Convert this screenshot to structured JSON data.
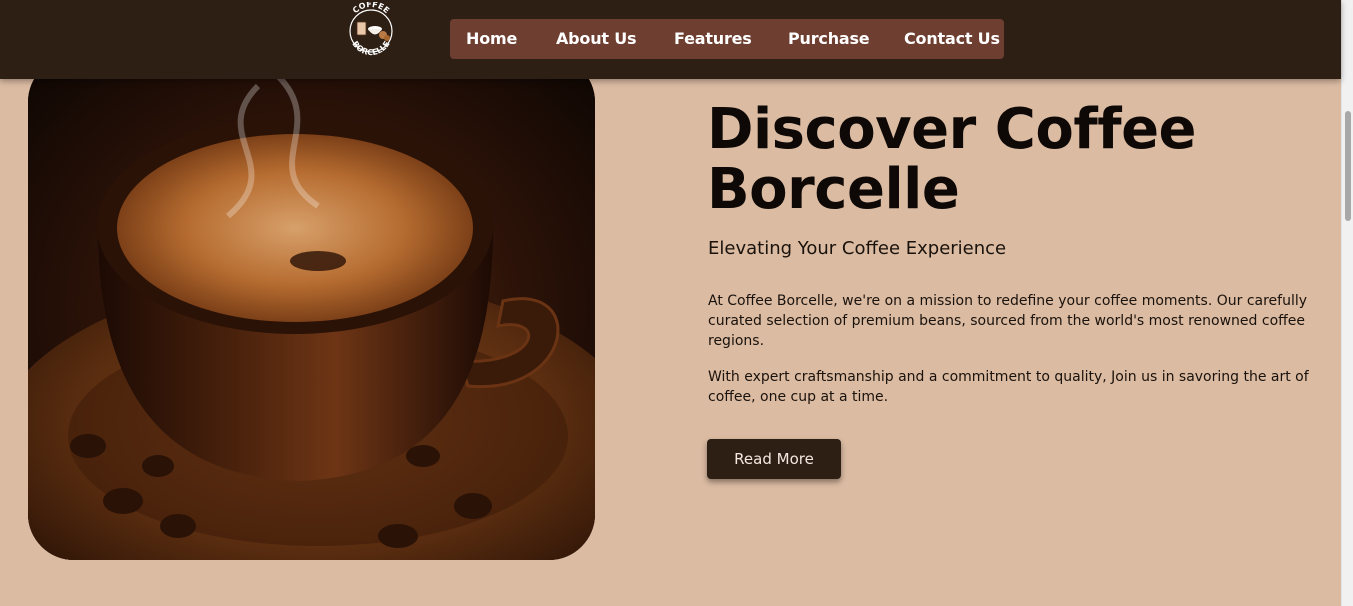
{
  "header": {
    "logo": {
      "text_top": "COFFEE",
      "text_bottom": "BORCELLE"
    },
    "nav": [
      {
        "label": "Home"
      },
      {
        "label": "About Us"
      },
      {
        "label": "Features"
      },
      {
        "label": "Purchase"
      },
      {
        "label": "Contact Us"
      }
    ]
  },
  "hero": {
    "image": "coffee-cup-photo",
    "title": "Discover Coffee Borcelle",
    "subtitle": "Elevating Your Coffee Experience",
    "paragraphs": [
      "At Coffee Borcelle, we're on a mission to redefine your coffee moments. Our carefully curated selection of premium beans, sourced from the world's most renowned coffee regions.",
      "With expert craftsmanship and a commitment to quality, Join us in savoring the art of coffee, one cup at a time."
    ],
    "button": "Read More"
  },
  "colors": {
    "header_bg": "#2e1f15",
    "nav_bg": "#6e3e31",
    "page_bg": "#dbbba2",
    "button_bg": "#2e1f15"
  }
}
